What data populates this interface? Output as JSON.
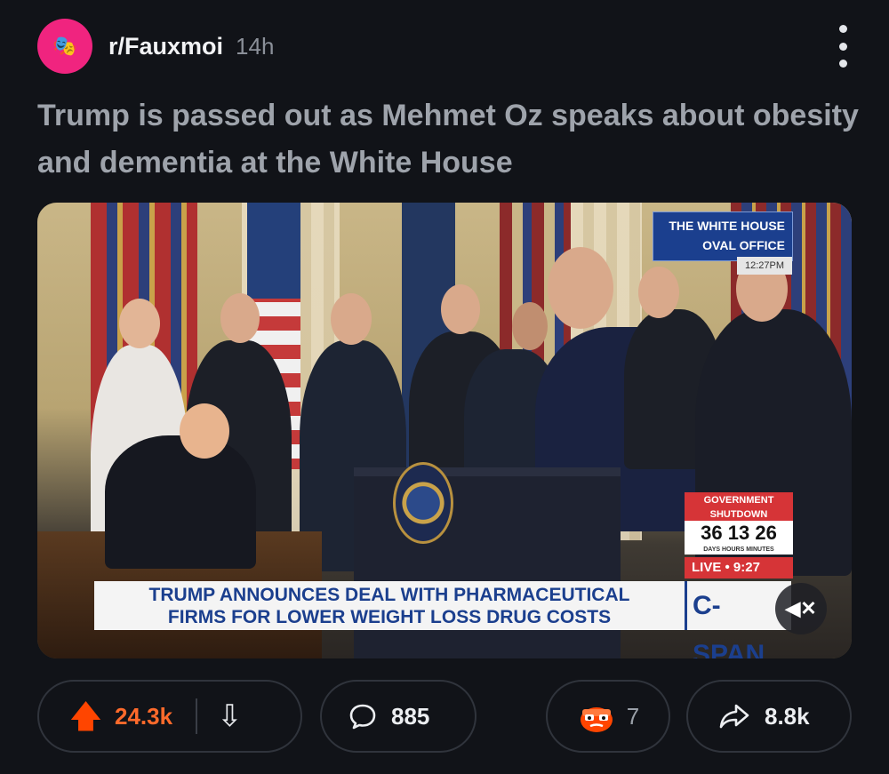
{
  "post": {
    "subreddit": "r/Fauxmoi",
    "age": "14h",
    "title": "Trump is passed out as Mehmet Oz speaks about obesity and dementia at the White House"
  },
  "media": {
    "location_line1": "THE WHITE HOUSE",
    "location_line2": "OVAL OFFICE",
    "time_stamp": "12:27PM",
    "shutdown_label_line1": "GOVERNMENT",
    "shutdown_label_line2": "SHUTDOWN",
    "countdown": "36 13 26",
    "countdown_units": "DAYS HOURS MINUTES",
    "live_label": "LIVE • 9:27",
    "headline_line1": "TRUMP ANNOUNCES DEAL WITH PHARMACEUTICAL",
    "headline_line2": "FIRMS FOR LOWER WEIGHT LOSS DRUG COSTS",
    "network": "C-SPAN",
    "mute_icon": "speaker-muted-icon"
  },
  "actions": {
    "upvotes": "24.3k",
    "comments": "885",
    "awards": "7",
    "shares": "8.8k"
  },
  "colors": {
    "background": "#111318",
    "upvote": "#ff4500",
    "cspan_blue": "#1b3f8e",
    "alert_red": "#d63437"
  }
}
